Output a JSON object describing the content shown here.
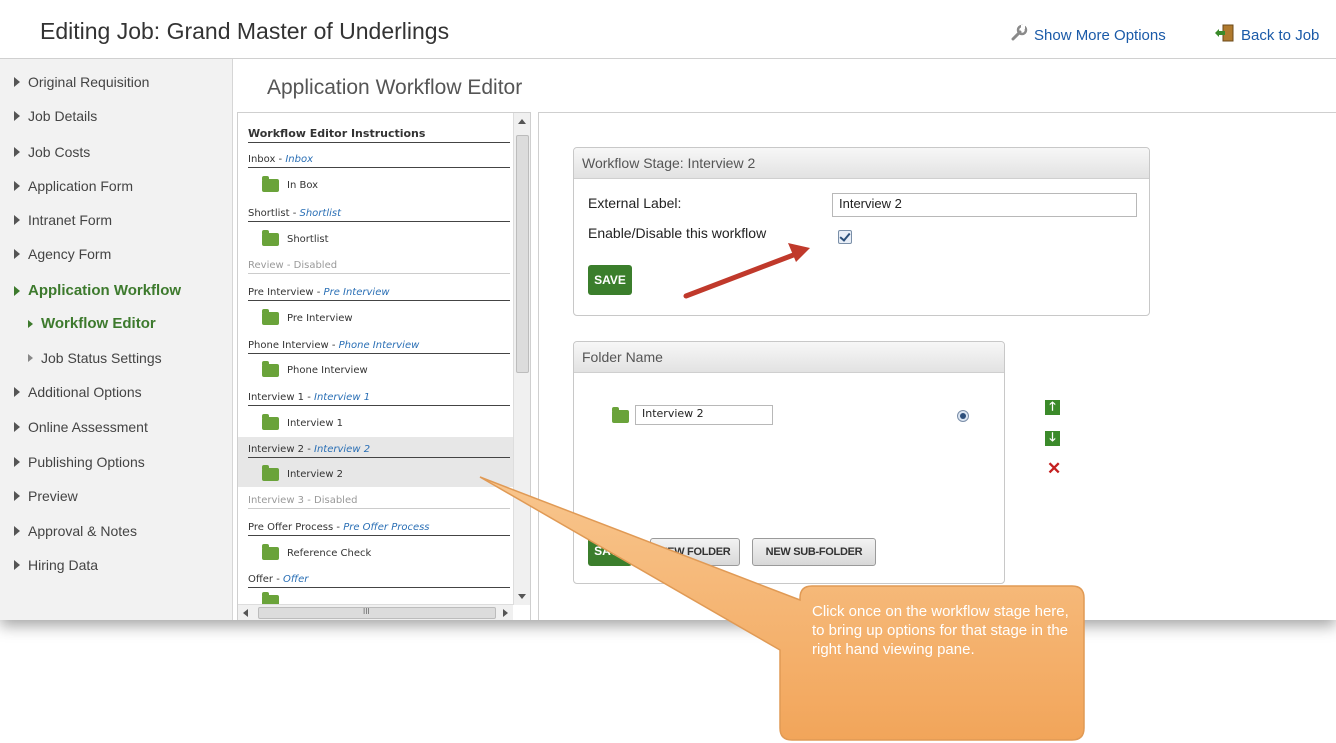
{
  "header": {
    "title": "Editing Job: Grand Master of Underlings",
    "show_more_label": "Show More Options",
    "back_label": "Back to Job"
  },
  "sidebar": {
    "items": [
      {
        "label": "Original Requisition"
      },
      {
        "label": "Job Details"
      },
      {
        "label": "Job Costs"
      },
      {
        "label": "Application Form"
      },
      {
        "label": "Intranet Form"
      },
      {
        "label": "Agency Form"
      },
      {
        "label": "Application Workflow"
      },
      {
        "label": "Workflow Editor"
      },
      {
        "label": "Job Status Settings"
      },
      {
        "label": "Additional Options"
      },
      {
        "label": "Online Assessment"
      },
      {
        "label": "Publishing Options"
      },
      {
        "label": "Preview"
      },
      {
        "label": "Approval & Notes"
      },
      {
        "label": "Hiring Data"
      }
    ]
  },
  "main": {
    "title": "Application Workflow Editor"
  },
  "tree": {
    "heading": "Workflow Editor Instructions",
    "rows": [
      {
        "name": "Inbox - ",
        "sub": "Inbox"
      },
      {
        "folder": "In Box"
      },
      {
        "name": "Shortlist - ",
        "sub": "Shortlist"
      },
      {
        "folder": "Shortlist"
      },
      {
        "name": "Review - Disabled"
      },
      {
        "name": "Pre Interview - ",
        "sub": "Pre Interview"
      },
      {
        "folder": "Pre Interview"
      },
      {
        "name": "Phone Interview - ",
        "sub": "Phone Interview"
      },
      {
        "folder": "Phone Interview"
      },
      {
        "name": "Interview 1 - ",
        "sub": "Interview 1"
      },
      {
        "folder": "Interview 1"
      },
      {
        "name": "Interview 2 - ",
        "sub": "Interview 2"
      },
      {
        "folder": "Interview 2"
      },
      {
        "name": "Interview 3 - Disabled"
      },
      {
        "name": "Pre Offer Process - ",
        "sub": "Pre Offer Process"
      },
      {
        "folder": "Reference Check"
      },
      {
        "name": "Offer - ",
        "sub": "Offer"
      }
    ],
    "hscroll_mark": "III"
  },
  "stage_panel": {
    "title": "Workflow Stage: Interview 2",
    "external_label": "External Label:",
    "external_value": "Interview 2",
    "enable_label": "Enable/Disable this workflow",
    "enabled": true,
    "save_label": "SAVE"
  },
  "folder_panel": {
    "title": "Folder Name",
    "folder_value": "Interview 2",
    "save_label": "SAVE",
    "new_folder_label": "NEW FOLDER",
    "new_subfolder_label": "NEW SUB-FOLDER",
    "up_glyph": "🡑",
    "down_glyph": "🡓",
    "delete_glyph": "✕"
  },
  "callout": {
    "text": "Click once on the workflow stage here, to bring up options for that stage in the right hand viewing pane."
  },
  "colors": {
    "accent_green": "#3b7e2c",
    "link_blue": "#1a5aa8",
    "arrow_red": "#c0392b",
    "callout_orange": "#f5b673"
  }
}
